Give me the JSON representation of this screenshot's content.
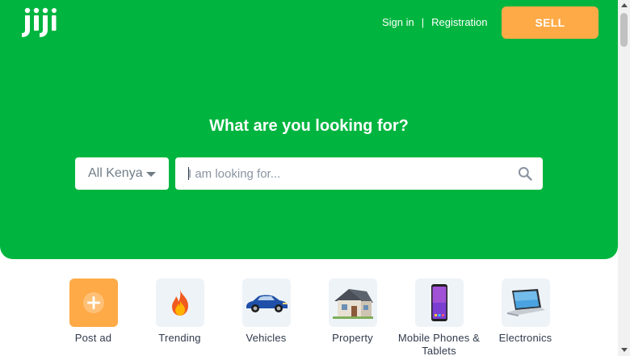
{
  "header": {
    "logo_text": "Jiji",
    "sign_in": "Sign in",
    "separator": "|",
    "registration": "Registration",
    "sell_label": "SELL"
  },
  "hero": {
    "title": "What are you looking for?",
    "region": "All Kenya",
    "search_placeholder": "I am looking for...",
    "search_value": ""
  },
  "categories": [
    {
      "label": "Post ad",
      "icon": "plus-icon"
    },
    {
      "label": "Trending",
      "icon": "fire-icon"
    },
    {
      "label": "Vehicles",
      "icon": "car-icon"
    },
    {
      "label": "Property",
      "icon": "house-icon"
    },
    {
      "label": "Mobile Phones &\nTablets",
      "icon": "phone-icon"
    },
    {
      "label": "Electronics",
      "icon": "laptop-icon"
    }
  ],
  "colors": {
    "brand_green": "#00b53f",
    "sell_orange": "#feaa47",
    "tile_bg": "#eef3f8",
    "text_dark": "#303a4b"
  }
}
